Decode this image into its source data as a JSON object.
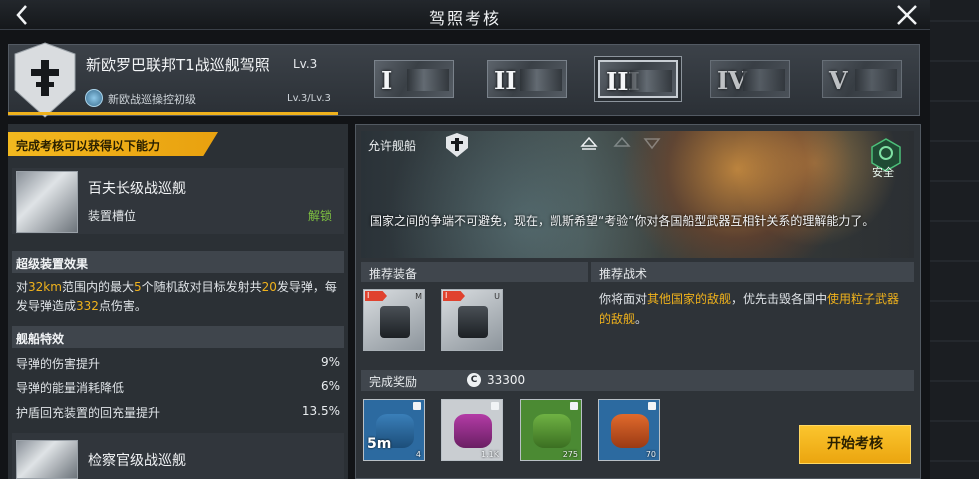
{
  "title": "驾照考核",
  "header": {
    "license_title": "新欧罗巴联邦T1战巡舰驾照",
    "level": "Lv.3",
    "sub_label": "新欧战巡操控初级",
    "progress": "Lv.3/Lv.3",
    "tiers": [
      {
        "label": "I",
        "state": "normal"
      },
      {
        "label": "II",
        "state": "normal"
      },
      {
        "label": "III",
        "state": "selected"
      },
      {
        "label": "IV",
        "state": "locked"
      },
      {
        "label": "V",
        "state": "locked"
      }
    ]
  },
  "left": {
    "banner": "完成考核可以获得以下能力",
    "ship1": {
      "name": "百夫长级战巡舰",
      "slot_label": "装置槽位",
      "status": "解锁"
    },
    "super_title": "超级装置效果",
    "super_desc": {
      "p1": "对",
      "range": "32km",
      "p2": "范围内的最大",
      "targets": "5",
      "p3": "个随机敌对目标发射共",
      "missiles": "20",
      "p4": "发导弹，每发导弹造成",
      "damage": "332",
      "p5": "点伤害。"
    },
    "trait_title": "舰船特效",
    "traits": [
      {
        "label": "导弹的伤害提升",
        "value": "9%"
      },
      {
        "label": "导弹的能量消耗降低",
        "value": "6%"
      },
      {
        "label": "护盾回充装置的回充量提升",
        "value": "13.5%"
      }
    ],
    "ship2": {
      "name": "检察官级战巡舰"
    }
  },
  "right": {
    "allowed_label": "允许舰船",
    "safe_label": "安全",
    "story": "国家之间的争端不可避免，现在，凯斯希望“考验”你对各国船型武器互相针关系的理解能力了。",
    "rec_equip_label": "推荐装备",
    "rec_tactic_label": "推荐战术",
    "tactic": {
      "p1": "你将面对",
      "hl1": "其他国家的敌舰",
      "p2": "，优先击毁各国中",
      "hl2": "使用粒子武器的敌舰",
      "p3": "。"
    },
    "equip": [
      {
        "lv": "I",
        "tag": "M"
      },
      {
        "lv": "I",
        "tag": "U"
      }
    ],
    "reward_label": "完成奖励",
    "credit_symbol": "C",
    "credits": "33300",
    "rewards": [
      {
        "qty": "4",
        "color": "blue",
        "time": "5m"
      },
      {
        "qty": "1.1K",
        "color": "pink"
      },
      {
        "qty": "275",
        "color": "green"
      },
      {
        "qty": "70",
        "color": "orange"
      }
    ],
    "start_button": "开始考核"
  },
  "colors": {
    "accent": "#f0b21c",
    "unlock": "#7fc241",
    "panel": "#2b3035"
  }
}
